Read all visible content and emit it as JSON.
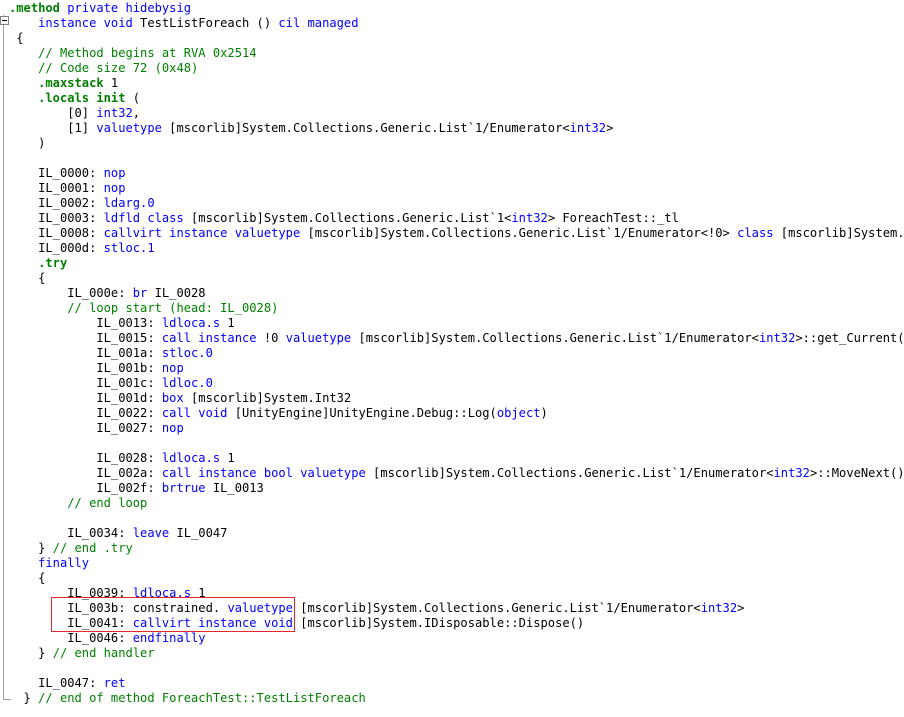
{
  "lines": [
    [
      {
        "s": ".method ",
        "c": "dir"
      },
      {
        "s": "private",
        "c": "kw"
      },
      {
        "s": " ",
        "c": "text"
      },
      {
        "s": "hidebysig",
        "c": "kw"
      }
    ],
    [
      {
        "s": "    ",
        "c": "text"
      },
      {
        "s": "instance void",
        "c": "kw"
      },
      {
        "s": " TestListForeach () ",
        "c": "text"
      },
      {
        "s": "cil managed",
        "c": "kw"
      }
    ],
    [
      {
        "s": " {",
        "c": "text"
      }
    ],
    [
      {
        "s": "    // Method begins at RVA 0x2514",
        "c": "comment"
      }
    ],
    [
      {
        "s": "    // Code size 72 (0x48)",
        "c": "comment"
      }
    ],
    [
      {
        "s": "    ",
        "c": "text"
      },
      {
        "s": ".maxstack",
        "c": "dir"
      },
      {
        "s": " 1",
        "c": "text"
      }
    ],
    [
      {
        "s": "    ",
        "c": "text"
      },
      {
        "s": ".locals init",
        "c": "dir"
      },
      {
        "s": " (",
        "c": "text"
      }
    ],
    [
      {
        "s": "        [0] ",
        "c": "text"
      },
      {
        "s": "int32",
        "c": "kw"
      },
      {
        "s": ",",
        "c": "text"
      }
    ],
    [
      {
        "s": "        [1] ",
        "c": "text"
      },
      {
        "s": "valuetype",
        "c": "kw"
      },
      {
        "s": " [mscorlib]System.Collections.Generic.List`1/Enumerator<",
        "c": "text"
      },
      {
        "s": "int32",
        "c": "kw"
      },
      {
        "s": ">",
        "c": "text"
      }
    ],
    [
      {
        "s": "    )",
        "c": "text"
      }
    ],
    [],
    [
      {
        "s": "    IL_0000: ",
        "c": "text"
      },
      {
        "s": "nop",
        "c": "kw"
      }
    ],
    [
      {
        "s": "    IL_0001: ",
        "c": "text"
      },
      {
        "s": "nop",
        "c": "kw"
      }
    ],
    [
      {
        "s": "    IL_0002: ",
        "c": "text"
      },
      {
        "s": "ldarg.0",
        "c": "kw"
      }
    ],
    [
      {
        "s": "    IL_0003: ",
        "c": "text"
      },
      {
        "s": "ldfld",
        "c": "kw"
      },
      {
        "s": " ",
        "c": "text"
      },
      {
        "s": "class",
        "c": "kw"
      },
      {
        "s": " [mscorlib]System.Collections.Generic.List`1<",
        "c": "text"
      },
      {
        "s": "int32",
        "c": "kw"
      },
      {
        "s": "> ForeachTest::_tl",
        "c": "text"
      }
    ],
    [
      {
        "s": "    IL_0008: ",
        "c": "text"
      },
      {
        "s": "callvirt instance valuetype",
        "c": "kw"
      },
      {
        "s": " [mscorlib]System.Collections.Generic.List`1/Enumerator<!0> ",
        "c": "text"
      },
      {
        "s": "class",
        "c": "kw"
      },
      {
        "s": " [mscorlib]System.Colle",
        "c": "text"
      }
    ],
    [
      {
        "s": "    IL_000d: ",
        "c": "text"
      },
      {
        "s": "stloc.1",
        "c": "kw"
      }
    ],
    [
      {
        "s": "    ",
        "c": "text"
      },
      {
        "s": ".try",
        "c": "dir"
      }
    ],
    [
      {
        "s": "    {",
        "c": "text"
      }
    ],
    [
      {
        "s": "        IL_000e: ",
        "c": "text"
      },
      {
        "s": "br",
        "c": "kw"
      },
      {
        "s": " IL_0028",
        "c": "text"
      }
    ],
    [
      {
        "s": "        // loop start (head: IL_0028)",
        "c": "comment"
      }
    ],
    [
      {
        "s": "            IL_0013: ",
        "c": "text"
      },
      {
        "s": "ldloca.s",
        "c": "kw"
      },
      {
        "s": " 1",
        "c": "text"
      }
    ],
    [
      {
        "s": "            IL_0015: ",
        "c": "text"
      },
      {
        "s": "call instance",
        "c": "kw"
      },
      {
        "s": " !0 ",
        "c": "text"
      },
      {
        "s": "valuetype",
        "c": "kw"
      },
      {
        "s": " [mscorlib]System.Collections.Generic.List`1/Enumerator<",
        "c": "text"
      },
      {
        "s": "int32",
        "c": "kw"
      },
      {
        "s": ">::get_Current()",
        "c": "text"
      }
    ],
    [
      {
        "s": "            IL_001a: ",
        "c": "text"
      },
      {
        "s": "stloc.0",
        "c": "kw"
      }
    ],
    [
      {
        "s": "            IL_001b: ",
        "c": "text"
      },
      {
        "s": "nop",
        "c": "kw"
      }
    ],
    [
      {
        "s": "            IL_001c: ",
        "c": "text"
      },
      {
        "s": "ldloc.0",
        "c": "kw"
      }
    ],
    [
      {
        "s": "            IL_001d: ",
        "c": "text"
      },
      {
        "s": "box",
        "c": "kw"
      },
      {
        "s": " [mscorlib]System.Int32",
        "c": "text"
      }
    ],
    [
      {
        "s": "            IL_0022: ",
        "c": "text"
      },
      {
        "s": "call void",
        "c": "kw"
      },
      {
        "s": " [UnityEngine]UnityEngine.Debug::Log(",
        "c": "text"
      },
      {
        "s": "object",
        "c": "kw"
      },
      {
        "s": ")",
        "c": "text"
      }
    ],
    [
      {
        "s": "            IL_0027: ",
        "c": "text"
      },
      {
        "s": "nop",
        "c": "kw"
      }
    ],
    [],
    [
      {
        "s": "            IL_0028: ",
        "c": "text"
      },
      {
        "s": "ldloca.s",
        "c": "kw"
      },
      {
        "s": " 1",
        "c": "text"
      }
    ],
    [
      {
        "s": "            IL_002a: ",
        "c": "text"
      },
      {
        "s": "call instance bool valuetype",
        "c": "kw"
      },
      {
        "s": " [mscorlib]System.Collections.Generic.List`1/Enumerator<",
        "c": "text"
      },
      {
        "s": "int32",
        "c": "kw"
      },
      {
        "s": ">::MoveNext()",
        "c": "text"
      }
    ],
    [
      {
        "s": "            IL_002f: ",
        "c": "text"
      },
      {
        "s": "brtrue",
        "c": "kw"
      },
      {
        "s": " IL_0013",
        "c": "text"
      }
    ],
    [
      {
        "s": "        // end loop",
        "c": "comment"
      }
    ],
    [],
    [
      {
        "s": "        IL_0034: ",
        "c": "text"
      },
      {
        "s": "leave",
        "c": "kw"
      },
      {
        "s": " IL_0047",
        "c": "text"
      }
    ],
    [
      {
        "s": "    } ",
        "c": "text"
      },
      {
        "s": "// end .try",
        "c": "comment"
      }
    ],
    [
      {
        "s": "    ",
        "c": "text"
      },
      {
        "s": "finally",
        "c": "kw"
      }
    ],
    [
      {
        "s": "    {",
        "c": "text"
      }
    ],
    [
      {
        "s": "        IL_0039: ",
        "c": "text"
      },
      {
        "s": "ldloca.s",
        "c": "kw"
      },
      {
        "s": " 1",
        "c": "text"
      }
    ],
    [
      {
        "s": "        IL_003b: ",
        "c": "text"
      },
      {
        "s": "constrained.",
        "c": "text"
      },
      {
        "s": " ",
        "c": "text"
      },
      {
        "s": "valuetype",
        "c": "kw"
      },
      {
        "s": " [mscorlib]System.Collections.Generic.List`1/Enumerator<",
        "c": "text"
      },
      {
        "s": "int32",
        "c": "kw"
      },
      {
        "s": ">",
        "c": "text"
      }
    ],
    [
      {
        "s": "        IL_0041: ",
        "c": "text"
      },
      {
        "s": "callvirt instance void",
        "c": "kw"
      },
      {
        "s": " [mscorlib]System.IDisposable::Dispose()",
        "c": "text"
      }
    ],
    [
      {
        "s": "        IL_0046: ",
        "c": "text"
      },
      {
        "s": "endfinally",
        "c": "kw"
      }
    ],
    [
      {
        "s": "    } ",
        "c": "text"
      },
      {
        "s": "// end handler",
        "c": "comment"
      }
    ],
    [],
    [
      {
        "s": "    IL_0047: ",
        "c": "text"
      },
      {
        "s": "ret",
        "c": "kw"
      }
    ],
    [
      {
        "s": "  } ",
        "c": "text"
      },
      {
        "s": "// end of method ForeachTest::TestListForeach",
        "c": "comment"
      }
    ]
  ]
}
